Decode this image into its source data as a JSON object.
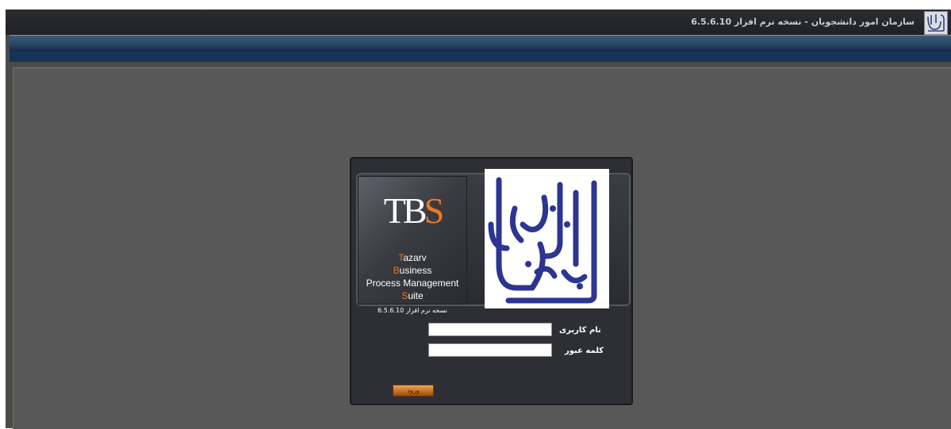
{
  "header": {
    "title": "سازمان امور دانشجویان  -  نسخه نرم افزار  6.5.6.10",
    "logo_icon": "organization-seal-icon"
  },
  "brand": {
    "logo": {
      "t": "T",
      "b": "B",
      "s": "S"
    },
    "lines": [
      {
        "first": "T",
        "rest": "azarv"
      },
      {
        "first": "B",
        "rest": "usiness"
      },
      {
        "first": "",
        "rest": "Process Management"
      },
      {
        "first": "S",
        "rest": "uite"
      }
    ],
    "version": "نسخه نرم افزار 6.5.6.10",
    "accent_color": "#ee7a1e"
  },
  "seal": {
    "icon": "organization-calligraphy-seal-icon",
    "color": "#2c3591"
  },
  "login": {
    "username_label": "نام کاربری",
    "username_value": "",
    "password_label": "کلمه عبور",
    "password_value": "",
    "submit_label": "ورود"
  }
}
